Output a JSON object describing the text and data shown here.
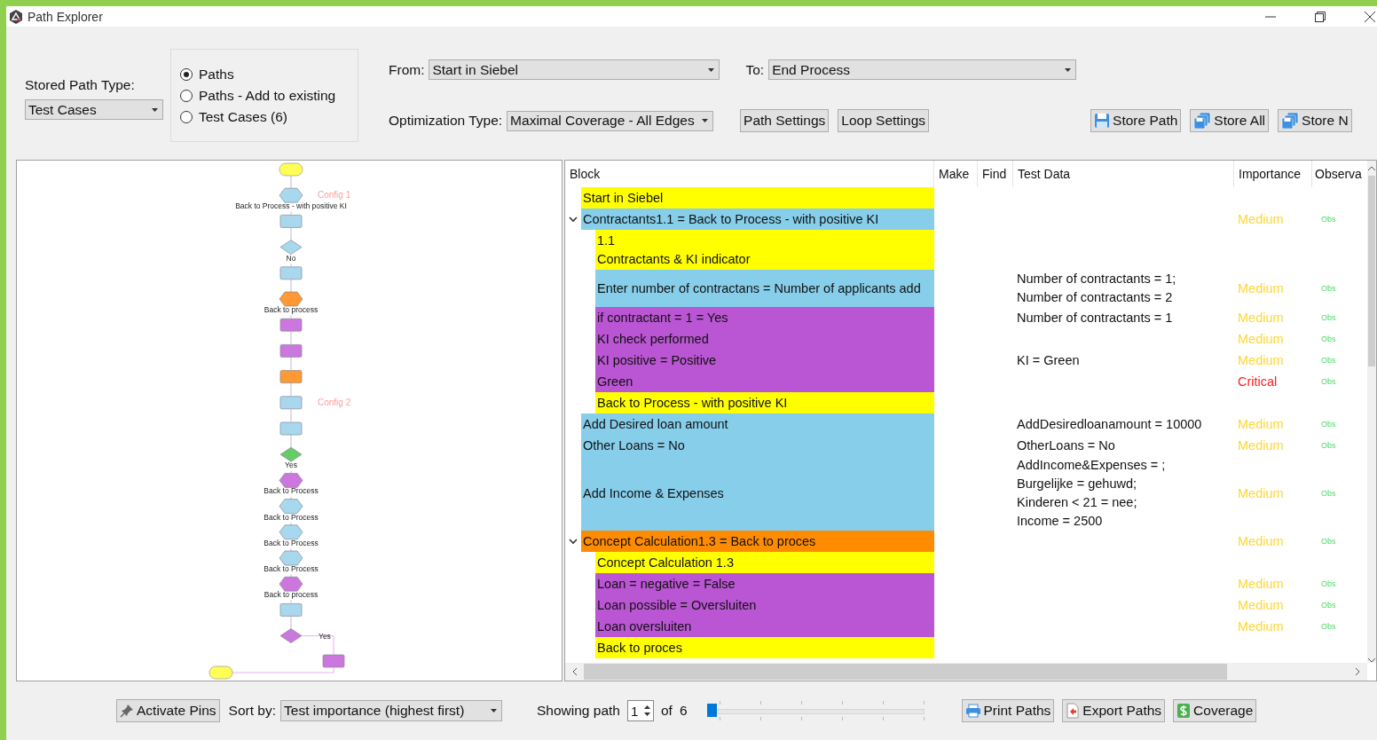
{
  "window": {
    "title": "Path Explorer"
  },
  "stored_path_type": {
    "label": "Stored Path Type:",
    "value": "Test Cases"
  },
  "path_options": [
    {
      "label": "Paths",
      "selected": true
    },
    {
      "label": "Paths - Add to existing",
      "selected": false
    },
    {
      "label": "Test Cases (6)",
      "selected": false
    }
  ],
  "from": {
    "label": "From:",
    "value": "Start in Siebel"
  },
  "to": {
    "label": "To:",
    "value": "End Process"
  },
  "optimization": {
    "label": "Optimization Type:",
    "value": "Maximal Coverage - All Edges"
  },
  "settings_buttons": [
    "Path Settings",
    "Loop Settings"
  ],
  "store_buttons": [
    {
      "label": "Store Path",
      "kind": "single"
    },
    {
      "label": "Store All",
      "kind": "multi"
    },
    {
      "label": "Store N",
      "kind": "multi"
    }
  ],
  "diagram": {
    "nodes": [
      {
        "kind": "oval",
        "color": "#ffff55"
      },
      {
        "kind": "hex",
        "color": "#a8d8ee",
        "label": "Back to Process - with positive KI",
        "note": "Config 1"
      },
      {
        "kind": "rect",
        "color": "#a8d8ee"
      },
      {
        "kind": "diamond",
        "color": "#a8d8ee",
        "label": "No"
      },
      {
        "kind": "rect",
        "color": "#a8d8ee"
      },
      {
        "kind": "hex",
        "color": "#ff9933",
        "label": "Back to process"
      },
      {
        "kind": "rect",
        "color": "#cc77dd"
      },
      {
        "kind": "rect",
        "color": "#cc77dd"
      },
      {
        "kind": "rect",
        "color": "#ff9933"
      },
      {
        "kind": "rect",
        "color": "#a8d8ee",
        "note": "Config 2"
      },
      {
        "kind": "rect",
        "color": "#a8d8ee"
      },
      {
        "kind": "diamond",
        "color": "#66cc66",
        "label": "Yes"
      },
      {
        "kind": "hex",
        "color": "#cc77dd",
        "label": "Back to Process"
      },
      {
        "kind": "hex",
        "color": "#a8d8ee",
        "label": "Back to Process"
      },
      {
        "kind": "hex",
        "color": "#a8d8ee",
        "label": "Back to Process"
      },
      {
        "kind": "hex",
        "color": "#a8d8ee",
        "label": "Back to Process"
      },
      {
        "kind": "hex",
        "color": "#cc77dd",
        "label": "Back to process"
      },
      {
        "kind": "rect",
        "color": "#a8d8ee"
      },
      {
        "kind": "diamond",
        "color": "#cc77dd"
      }
    ],
    "branch": {
      "kind": "rect",
      "color": "#cc77dd",
      "edge_label": "Yes"
    },
    "end": {
      "kind": "oval",
      "color": "#ffff55"
    }
  },
  "table": {
    "columns": [
      "Block",
      "Make",
      "Find",
      "Test Data",
      "Importance",
      "Observa"
    ],
    "rows": [
      {
        "block": "Start in Siebel",
        "color": "#ffff00"
      },
      {
        "block": "Contractants1.1 = Back to Process - with positive KI",
        "color": "#87ceeb",
        "expanded": true,
        "importance": {
          "text": "Medium",
          "color": "#ffd633"
        },
        "observation": "Obs",
        "children": [
          {
            "block": "1.1\nContractants & KI indicator",
            "color": "#ffff00"
          },
          {
            "block": "Enter number of contractans  = Number of applicants add",
            "color": "#87ceeb",
            "test_data": "Number of contractants = 1;\nNumber of contractants = 2",
            "importance": {
              "text": "Medium",
              "color": "#ffd633"
            },
            "observation": "Obs"
          },
          {
            "block": "if contractant = 1 = Yes",
            "color": "#ba55d3",
            "test_data": "Number of contractants = 1",
            "importance": {
              "text": "Medium",
              "color": "#ffd633"
            },
            "observation": "Obs"
          },
          {
            "block": "KI check performed",
            "color": "#ba55d3",
            "importance": {
              "text": "Medium",
              "color": "#ffd633"
            },
            "observation": "Obs"
          },
          {
            "block": "KI positive = Positive",
            "color": "#ba55d3",
            "test_data": "KI = Green",
            "importance": {
              "text": "Medium",
              "color": "#ffd633"
            },
            "observation": "Obs"
          },
          {
            "block": "Green",
            "color": "#ba55d3",
            "importance": {
              "text": "Critical",
              "color": "#ff2020"
            },
            "observation": "Obs"
          },
          {
            "block": "Back to Process - with positive KI",
            "color": "#ffff00"
          }
        ]
      },
      {
        "block": "Add Desired loan amount",
        "color": "#87ceeb",
        "test_data": "AddDesiredloanamount = 10000",
        "importance": {
          "text": "Medium",
          "color": "#ffd633"
        },
        "observation": "Obs"
      },
      {
        "block": "Other Loans = No",
        "color": "#87ceeb",
        "test_data": "OtherLoans = No",
        "importance": {
          "text": "Medium",
          "color": "#ffd633"
        },
        "observation": "Obs"
      },
      {
        "block": "Add Income & Expenses",
        "color": "#87ceeb",
        "test_data": "AddIncome&Expenses = ;\nBurgelijke  = gehuwd;\nKinderen < 21 = nee;\nIncome = 2500",
        "importance": {
          "text": "Medium",
          "color": "#ffd633"
        },
        "observation": "Obs"
      },
      {
        "block": "Concept Calculation1.3 = Back to proces",
        "color": "#ff8c00",
        "expanded": true,
        "importance": {
          "text": "Medium",
          "color": "#ffd633"
        },
        "observation": "Obs",
        "children": [
          {
            "block": "Concept Calculation 1.3",
            "color": "#ffff00"
          },
          {
            "block": "Loan = negative = False",
            "color": "#ba55d3",
            "importance": {
              "text": "Medium",
              "color": "#ffd633"
            },
            "observation": "Obs"
          },
          {
            "block": "Loan possible = Oversluiten",
            "color": "#ba55d3",
            "importance": {
              "text": "Medium",
              "color": "#ffd633"
            },
            "observation": "Obs"
          },
          {
            "block": "Loan oversluiten",
            "color": "#ba55d3",
            "importance": {
              "text": "Medium",
              "color": "#ffd633"
            },
            "observation": "Obs"
          },
          {
            "block": "Back to proces",
            "color": "#ffff00"
          }
        ]
      }
    ]
  },
  "bottom": {
    "activate_pins": "Activate Pins",
    "sort_label": "Sort by:",
    "sort_value": "Test importance (highest first)",
    "showing_label": "Showing path",
    "path_number": "1",
    "of_label": "of",
    "path_total": "6",
    "path_slider": {
      "level": 0
    },
    "buttons": [
      {
        "label": "Print Paths",
        "kind": "print"
      },
      {
        "label": "Export Paths",
        "kind": "export"
      },
      {
        "label": "Coverage",
        "kind": "coverage"
      }
    ]
  }
}
